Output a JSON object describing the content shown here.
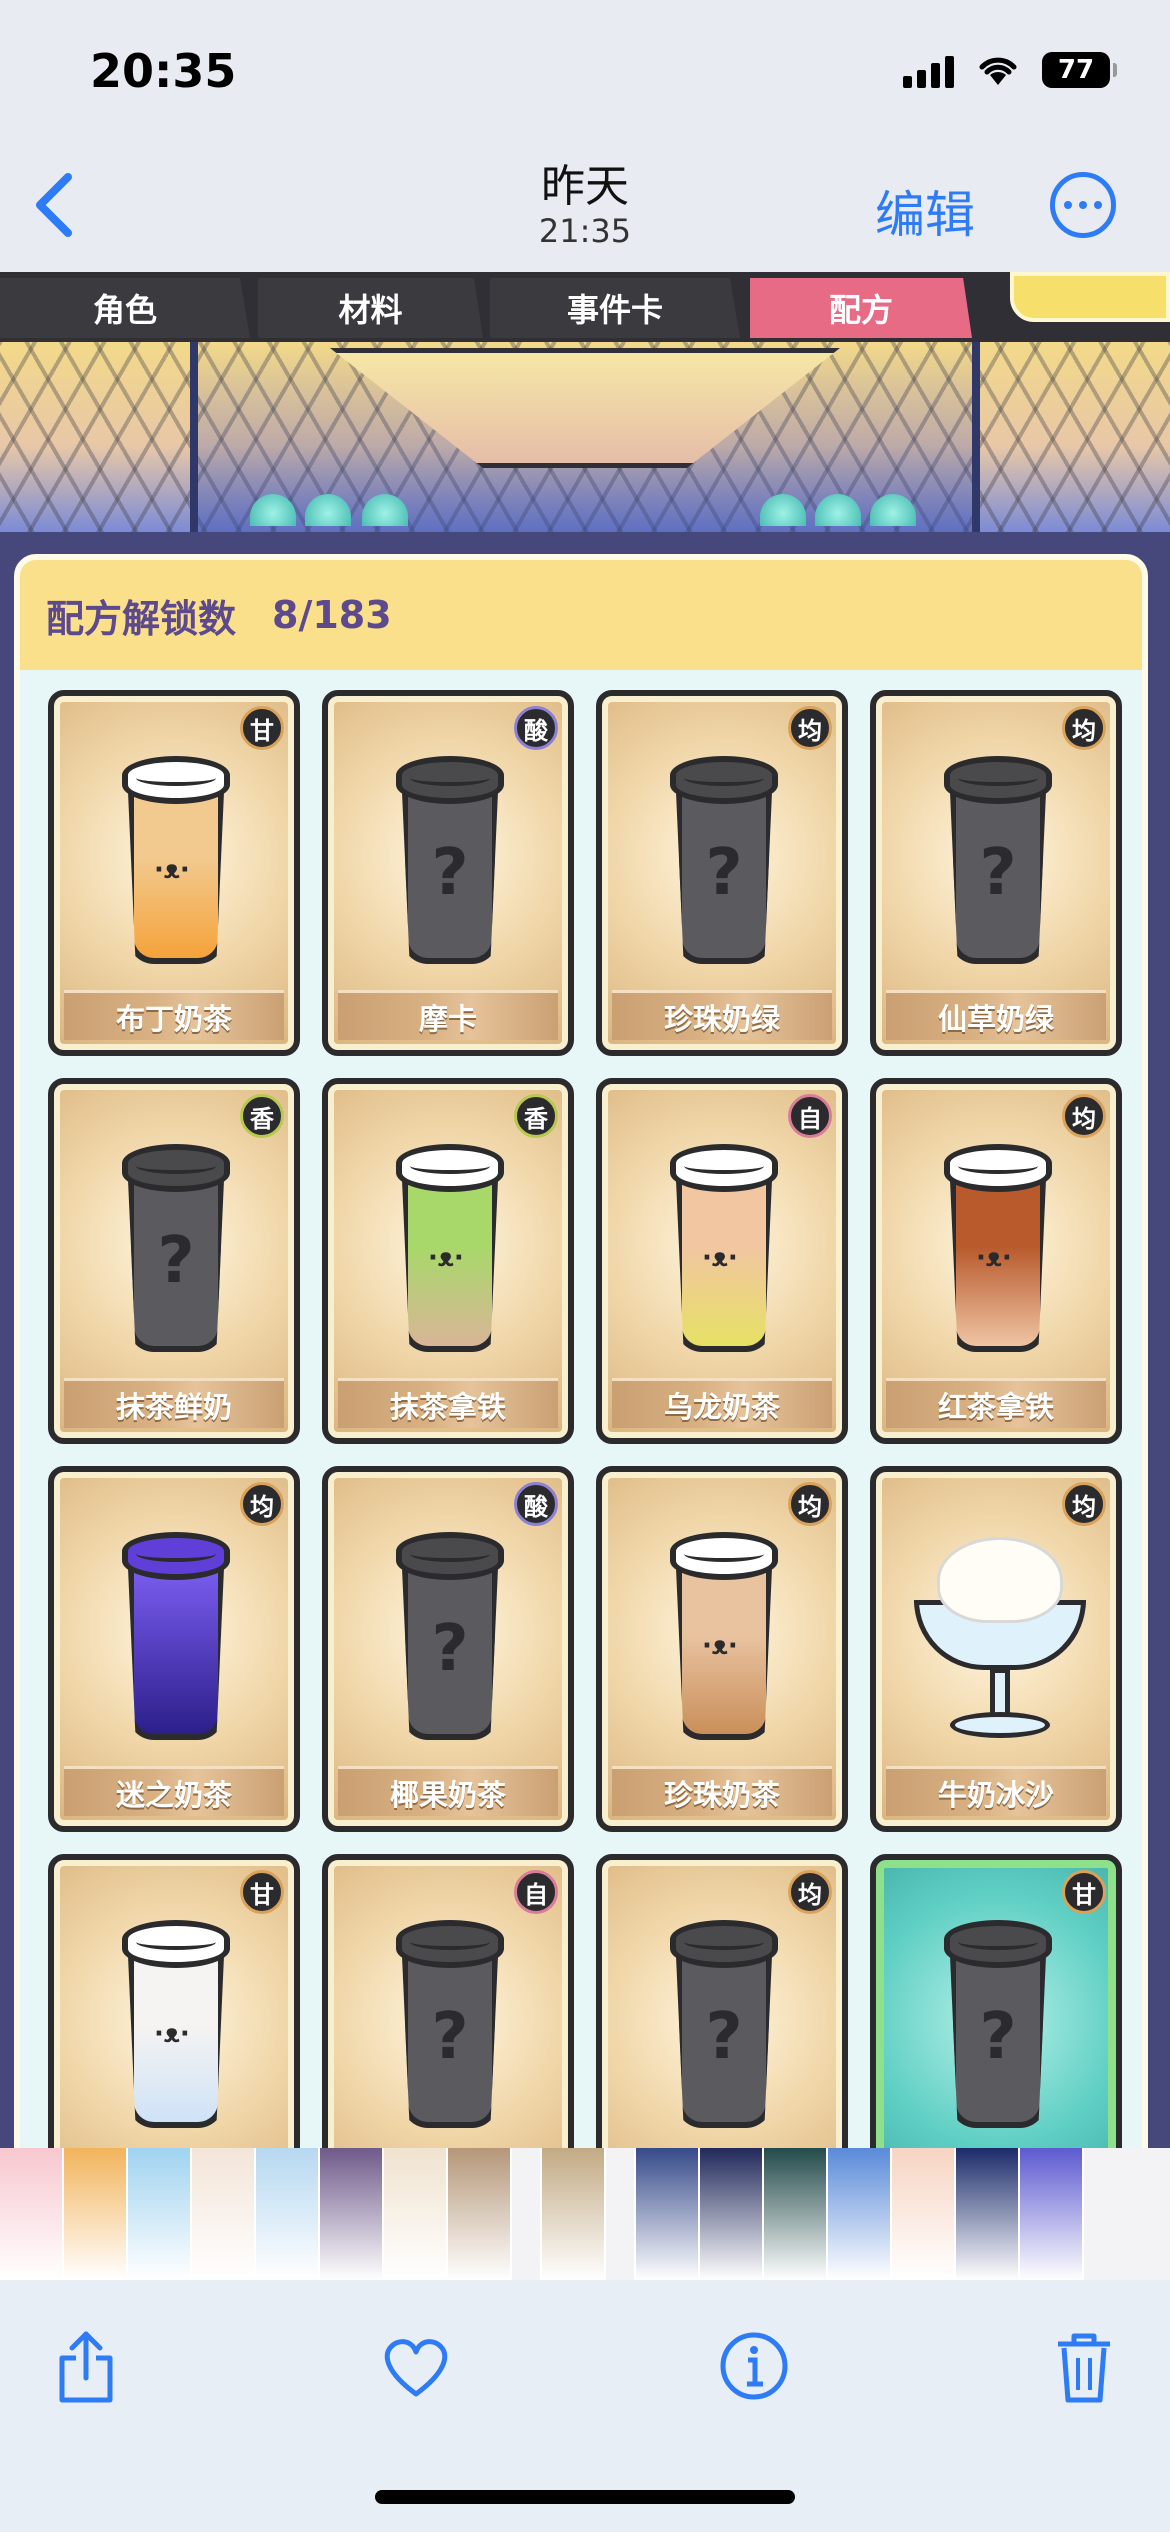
{
  "status_bar": {
    "time": "20:35",
    "battery": "77"
  },
  "nav": {
    "title": "昨天",
    "subtitle": "21:35",
    "edit_label": "编辑"
  },
  "game": {
    "tabs": [
      {
        "label": "角色",
        "active": false
      },
      {
        "label": "材料",
        "active": false
      },
      {
        "label": "事件卡",
        "active": false
      },
      {
        "label": "配方",
        "active": true
      }
    ],
    "panel_title": "配方解锁数",
    "unlock_count": "8/183",
    "recipes": [
      {
        "name": "布丁奶茶",
        "tag": "甘",
        "state": "unlocked",
        "liquid": [
          "#f2c98e",
          "#f5a33a"
        ]
      },
      {
        "name": "摩卡",
        "tag": "酸",
        "state": "locked"
      },
      {
        "name": "珍珠奶绿",
        "tag": "均",
        "state": "locked"
      },
      {
        "name": "仙草奶绿",
        "tag": "均",
        "state": "locked"
      },
      {
        "name": "抹茶鲜奶",
        "tag": "香",
        "state": "locked"
      },
      {
        "name": "抹茶拿铁",
        "tag": "香",
        "state": "unlocked",
        "liquid": [
          "#a8d86a",
          "#d9b597"
        ]
      },
      {
        "name": "乌龙奶茶",
        "tag": "自",
        "state": "unlocked",
        "liquid": [
          "#f1c6a0",
          "#e6e165"
        ]
      },
      {
        "name": "红茶拿铁",
        "tag": "均",
        "state": "unlocked",
        "liquid": [
          "#b85a2c",
          "#efc4a4"
        ]
      },
      {
        "name": "迷之奶茶",
        "tag": "均",
        "state": "mystery"
      },
      {
        "name": "椰果奶茶",
        "tag": "酸",
        "state": "locked"
      },
      {
        "name": "珍珠奶茶",
        "tag": "均",
        "state": "unlocked",
        "liquid": [
          "#e9c3a0",
          "#c98f5a"
        ]
      },
      {
        "name": "牛奶冰沙",
        "tag": "均",
        "state": "sundae"
      },
      {
        "name": "",
        "tag": "甘",
        "state": "unlocked",
        "liquid": [
          "#f6f4f2",
          "#cfe2f7"
        ]
      },
      {
        "name": "",
        "tag": "自",
        "state": "locked"
      },
      {
        "name": "",
        "tag": "均",
        "state": "locked"
      },
      {
        "name": "",
        "tag": "甘",
        "state": "rare-locked"
      }
    ]
  },
  "thumbnails": [
    "#f7c7cf",
    "#f2b45c",
    "#9fd3ef",
    "#f3e5d8",
    "#b6d8f0",
    "#6f5a8a",
    "#f0e3cf",
    "#b59779",
    "gap",
    "#c2aa84",
    "gap",
    "#364a8a",
    "#21295a",
    "#234a4a",
    "#5a8ad9",
    "#f7d4c3",
    "#1b2b6a",
    "#5d5ad0"
  ],
  "colors": {
    "accent": "#2e7bf6",
    "active_tab": "#e86b86",
    "panel_header": "#fbe08b"
  }
}
